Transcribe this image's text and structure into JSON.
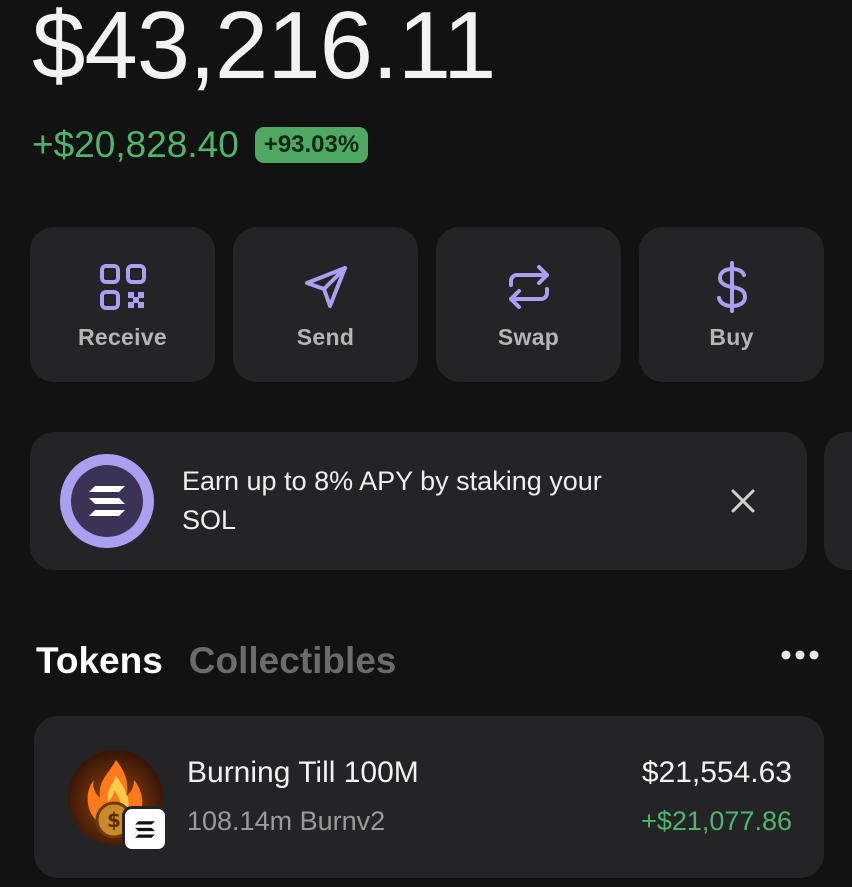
{
  "balance": {
    "total": "$43,216.11",
    "change_amount": "+$20,828.40",
    "change_percent": "+93.03%"
  },
  "actions": [
    {
      "label": "Receive",
      "icon": "qr-code-icon"
    },
    {
      "label": "Send",
      "icon": "send-icon"
    },
    {
      "label": "Swap",
      "icon": "swap-icon"
    },
    {
      "label": "Buy",
      "icon": "dollar-icon"
    }
  ],
  "promo": {
    "text": "Earn up to 8% APY by staking your SOL",
    "icon": "solana-logo-icon",
    "close_icon": "close-icon"
  },
  "tabs": [
    {
      "label": "Tokens",
      "active": true
    },
    {
      "label": "Collectibles",
      "active": false
    }
  ],
  "tokens": [
    {
      "name": "Burning Till 100M",
      "amount": "108.14m Burnv2",
      "value": "$21,554.63",
      "change": "+$21,077.86"
    }
  ],
  "colors": {
    "background": "#121212",
    "card": "#242426",
    "accent": "#ab9ff2",
    "positive": "#4fb56b"
  }
}
